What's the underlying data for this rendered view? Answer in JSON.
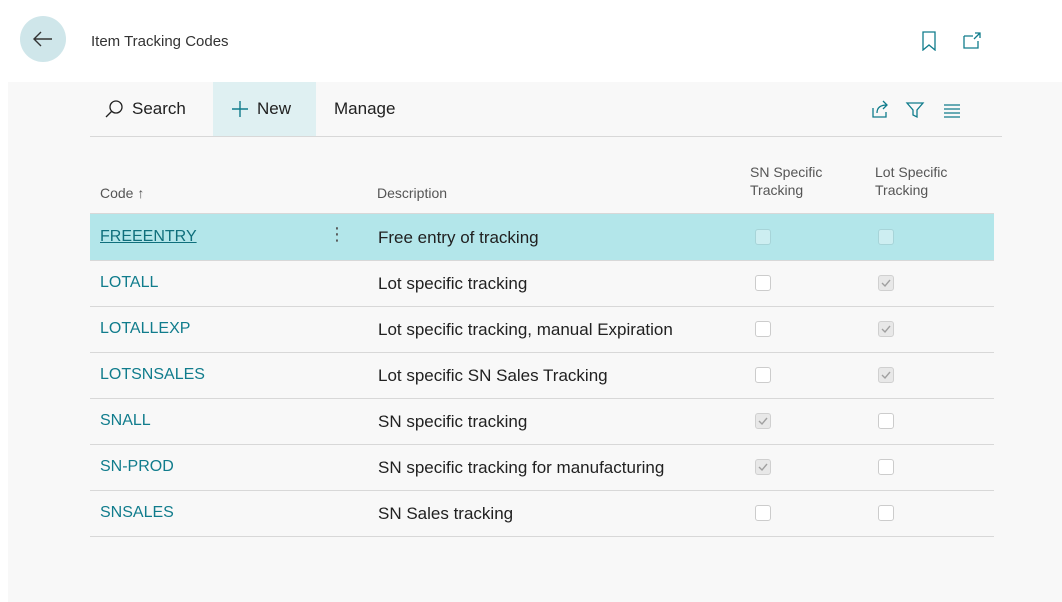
{
  "header": {
    "title": "Item Tracking Codes"
  },
  "actions": {
    "search": "Search",
    "new": "New",
    "manage": "Manage"
  },
  "columns": {
    "code": "Code ↑",
    "description": "Description",
    "sn_specific_line1": "SN Specific",
    "sn_specific_line2": "Tracking",
    "lot_specific_line1": "Lot Specific",
    "lot_specific_line2": "Tracking"
  },
  "rows": [
    {
      "code": "FREEENTRY",
      "description": "Free entry of tracking",
      "sn": false,
      "lot": false,
      "selected": true
    },
    {
      "code": "LOTALL",
      "description": "Lot specific tracking",
      "sn": false,
      "lot": true
    },
    {
      "code": "LOTALLEXP",
      "description": "Lot specific tracking, manual Expiration",
      "sn": false,
      "lot": true
    },
    {
      "code": "LOTSNSALES",
      "description": "Lot specific SN Sales Tracking",
      "sn": false,
      "lot": true
    },
    {
      "code": "SNALL",
      "description": "SN specific tracking",
      "sn": true,
      "lot": false
    },
    {
      "code": "SN-PROD",
      "description": "SN specific tracking for manufacturing",
      "sn": true,
      "lot": false
    },
    {
      "code": "SNSALES",
      "description": "SN Sales tracking",
      "sn": false,
      "lot": false
    }
  ],
  "colors": {
    "accent": "#107c8c",
    "selected_row": "#b3e6ea",
    "back_button": "#cfe6ea"
  }
}
